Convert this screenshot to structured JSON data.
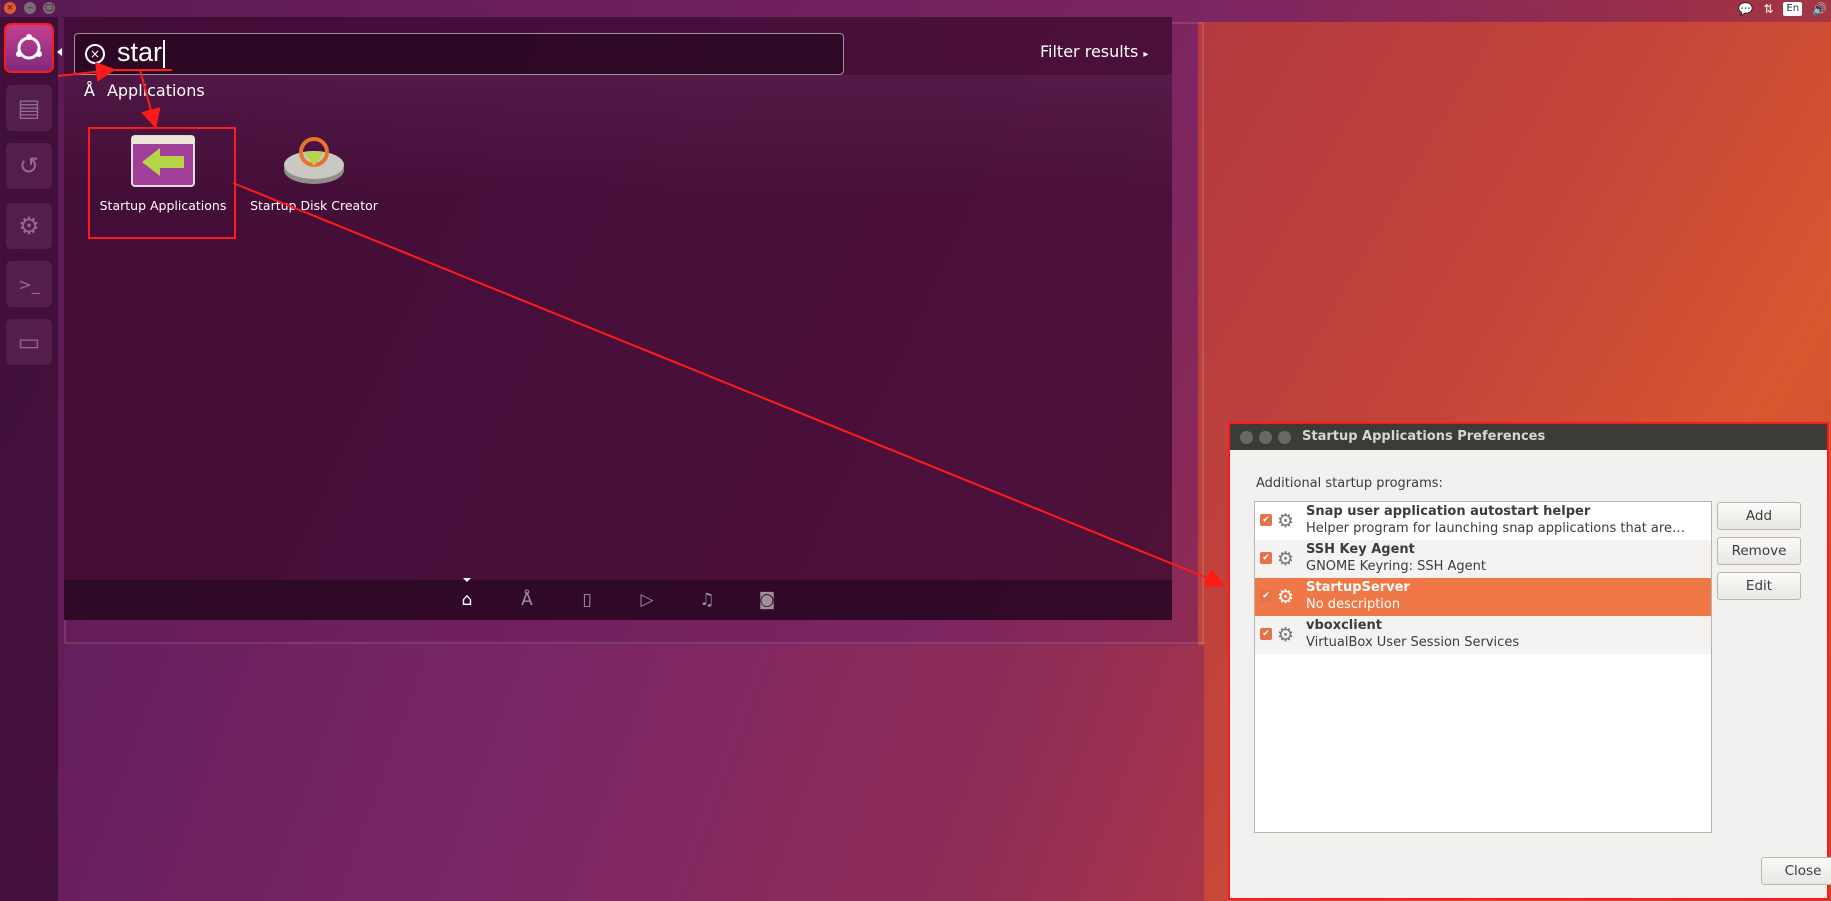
{
  "dash": {
    "search": {
      "value": "star"
    },
    "filter_label": "Filter results",
    "section_heading": "Applications",
    "apps": [
      {
        "label": "Startup Applications",
        "icon": "startup-applications-icon"
      },
      {
        "label": "Startup Disk Creator",
        "icon": "disk-creator-icon"
      }
    ],
    "scopes": [
      "home",
      "applications",
      "files",
      "video",
      "music",
      "photos"
    ]
  },
  "launcher": {
    "items": [
      "ubuntu-home-icon",
      "files-icon",
      "backup-icon",
      "settings-icon",
      "terminal-icon",
      "startup-applications-icon"
    ]
  },
  "tray": {
    "lang": "En"
  },
  "dialog": {
    "title": "Startup Applications Preferences",
    "label": "Additional startup programs:",
    "items": [
      {
        "name": "Snap user application autostart helper",
        "desc": "Helper program for launching snap applications that are…",
        "checked": true,
        "selected": false
      },
      {
        "name": "SSH Key Agent",
        "desc": "GNOME Keyring: SSH Agent",
        "checked": true,
        "selected": false
      },
      {
        "name": "StartupServer",
        "desc": "No description",
        "checked": true,
        "selected": true
      },
      {
        "name": "vboxclient",
        "desc": "VirtualBox User Session Services",
        "checked": true,
        "selected": false
      }
    ],
    "buttons": {
      "add": "Add",
      "remove": "Remove",
      "edit": "Edit",
      "close": "Close"
    }
  },
  "colors": {
    "annotation": "#ff1a1a",
    "selection": "#f07746",
    "checkbox": "#e2734a"
  }
}
